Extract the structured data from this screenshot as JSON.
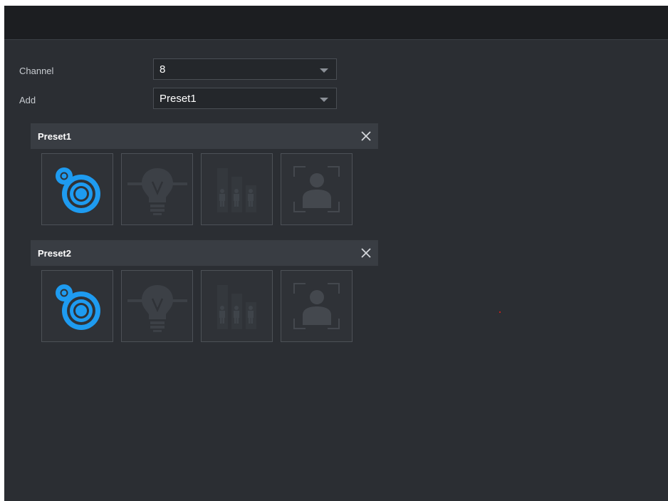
{
  "form": {
    "channel_label": "Channel",
    "channel_value": "8",
    "add_label": "Add",
    "add_value": "Preset1"
  },
  "presets": [
    {
      "title": "Preset1",
      "functions": [
        {
          "icon": "target-icon",
          "state": "active",
          "color": "#1e9bf0"
        },
        {
          "icon": "light-bulb-icon",
          "state": "inactive"
        },
        {
          "icon": "people-counting-icon",
          "state": "inactive"
        },
        {
          "icon": "face-detection-icon",
          "state": "inactive"
        }
      ]
    },
    {
      "title": "Preset2",
      "functions": [
        {
          "icon": "target-icon",
          "state": "active",
          "color": "#1e9bf0"
        },
        {
          "icon": "light-bulb-icon",
          "state": "inactive"
        },
        {
          "icon": "people-counting-icon",
          "state": "inactive"
        },
        {
          "icon": "face-detection-icon",
          "state": "inactive"
        }
      ]
    }
  ],
  "colors": {
    "accent": "#1e9bf0",
    "background": "#2b2e33",
    "header": "#1c1e21"
  }
}
